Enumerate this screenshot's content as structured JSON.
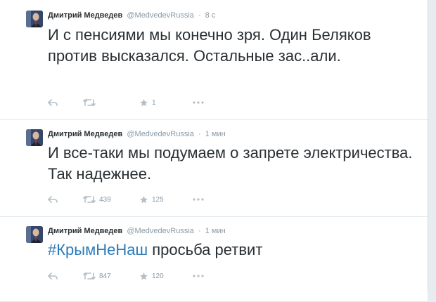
{
  "tweets": [
    {
      "author": "Дмитрий Медведев",
      "handle": "@MedvedevRussia",
      "separator": "·",
      "time": "8 с",
      "text": "И с пенсиями мы конечно зря. Один Беляков против высказался. Остальные зас..али.",
      "retweets": "",
      "favorites": "1"
    },
    {
      "author": "Дмитрий Медведев",
      "handle": "@MedvedevRussia",
      "separator": "·",
      "time": "1 мин",
      "text": "И все-таки мы подумаем о запрете электричества. Так надежнее.",
      "retweets": "439",
      "favorites": "125"
    },
    {
      "author": "Дмитрий Медведев",
      "handle": "@MedvedevRussia",
      "separator": "·",
      "time": "1 мин",
      "hashtag": "#КрымНеНаш",
      "text": " просьба ретвит",
      "retweets": "847",
      "favorites": "120"
    }
  ],
  "icons": {
    "reply": "reply-icon",
    "retweet": "retweet-icon",
    "favorite": "star-icon",
    "more": "more-icon"
  },
  "colors": {
    "text": "#292f33",
    "meta": "#8899a6",
    "hashtag": "#2b7bb9",
    "divider": "#e1e8ed"
  }
}
